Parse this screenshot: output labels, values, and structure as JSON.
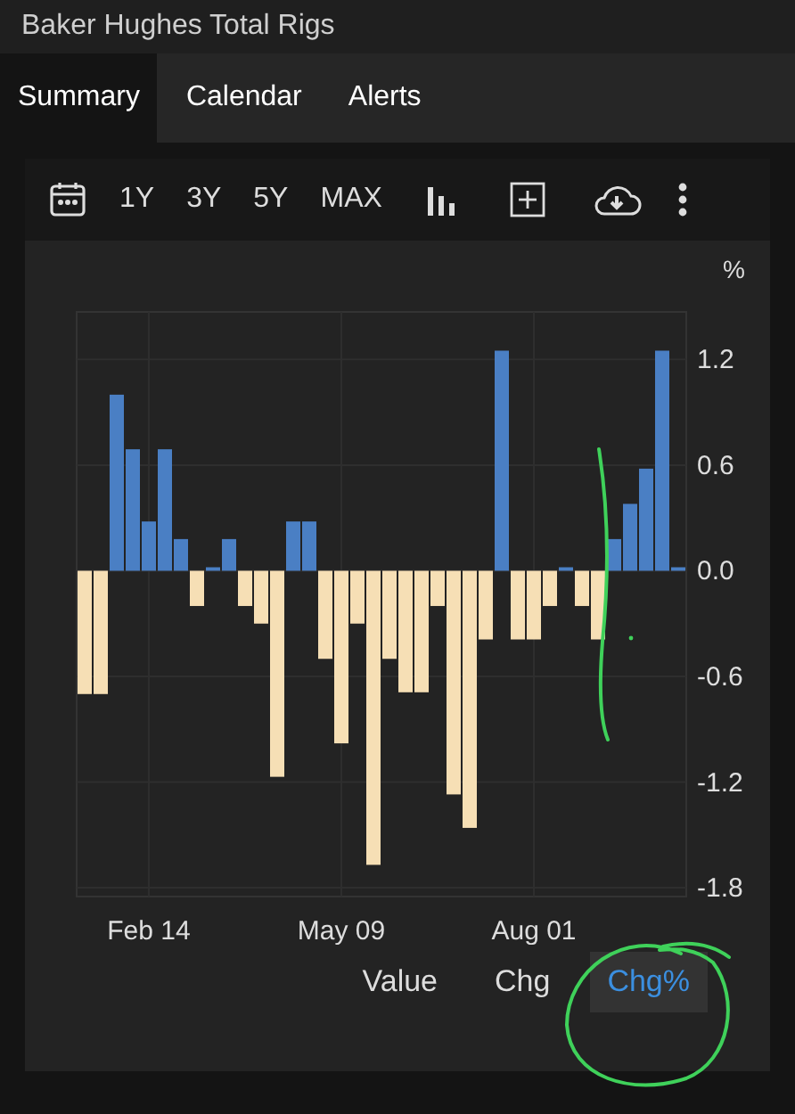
{
  "header": {
    "title": "Baker Hughes Total Rigs"
  },
  "tabs": [
    {
      "label": "Summary",
      "selected": true
    },
    {
      "label": "Calendar",
      "selected": false
    },
    {
      "label": "Alerts",
      "selected": false
    }
  ],
  "toolbar": {
    "ranges": [
      {
        "label": "1Y",
        "selected": false
      },
      {
        "label": "3Y",
        "selected": false
      },
      {
        "label": "5Y",
        "selected": false
      },
      {
        "label": "MAX",
        "selected": false
      }
    ]
  },
  "chart": {
    "unit": "%",
    "chart_data": {
      "type": "bar",
      "categories": [
        null,
        null,
        null,
        null,
        "Feb 14",
        null,
        null,
        null,
        null,
        null,
        null,
        null,
        null,
        null,
        null,
        null,
        "May 09",
        null,
        null,
        null,
        null,
        null,
        null,
        null,
        null,
        null,
        null,
        null,
        "Aug 01",
        null,
        null,
        null,
        null,
        null,
        null,
        null,
        null,
        null
      ],
      "series": [
        {
          "color": "#4a7fc4",
          "values": [
            null,
            null,
            1.0,
            0.69,
            0.28,
            0.69,
            0.18,
            null,
            0.02,
            0.18,
            null,
            null,
            null,
            0.28,
            0.28,
            null,
            null,
            null,
            null,
            null,
            null,
            null,
            null,
            null,
            null,
            null,
            1.25,
            null,
            null,
            null,
            0.02,
            null,
            null,
            0.18,
            0.38,
            0.58,
            1.25,
            0.02
          ]
        },
        {
          "color": "#f6dfb5",
          "values": [
            -0.7,
            -0.7,
            null,
            null,
            null,
            null,
            null,
            -0.2,
            null,
            null,
            -0.2,
            -0.3,
            -1.17,
            null,
            null,
            -0.5,
            -0.98,
            -0.3,
            -1.67,
            -0.5,
            -0.69,
            -0.69,
            -0.2,
            -1.27,
            -1.46,
            -0.39,
            null,
            -0.39,
            -0.39,
            -0.2,
            null,
            -0.2,
            -0.39,
            null,
            null,
            null,
            null,
            null
          ]
        }
      ],
      "ylim": [
        -1.85,
        1.47
      ],
      "grid": true,
      "yticks": [
        {
          "value": 1.2,
          "label": "1.2"
        },
        {
          "value": 0.6,
          "label": "0.6"
        },
        {
          "value": 0,
          "label": "0.0"
        },
        {
          "value": -0.6,
          "label": "-0.6"
        },
        {
          "value": -1.2,
          "label": "-1.2"
        },
        {
          "value": -1.8,
          "label": "-1.8"
        }
      ]
    }
  },
  "modes": [
    {
      "label": "Value",
      "selected": false
    },
    {
      "label": "Chg",
      "selected": false
    },
    {
      "label": "Chg%",
      "selected": true
    }
  ]
}
